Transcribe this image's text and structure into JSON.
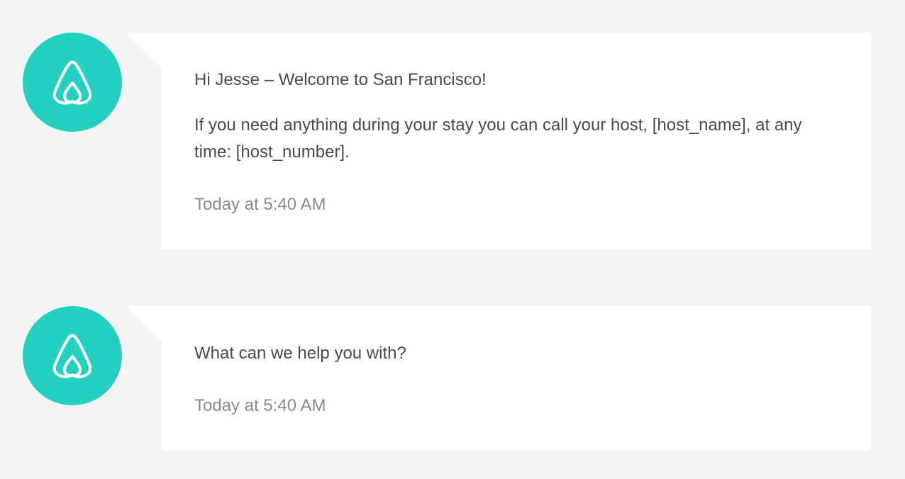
{
  "brand": {
    "accent_color": "#24d0c0",
    "logo_icon": "airbnb-belo-icon"
  },
  "messages": [
    {
      "avatar_icon": "airbnb-belo-icon",
      "paragraphs": [
        "Hi Jesse – Welcome to San Francisco!",
        "If you need anything during your stay you can call your host, [host_name], at any time: [host_number]."
      ],
      "timestamp": "Today at 5:40 AM"
    },
    {
      "avatar_icon": "airbnb-belo-icon",
      "paragraphs": [
        "What can we help you with?"
      ],
      "timestamp": "Today at 5:40 AM"
    }
  ]
}
